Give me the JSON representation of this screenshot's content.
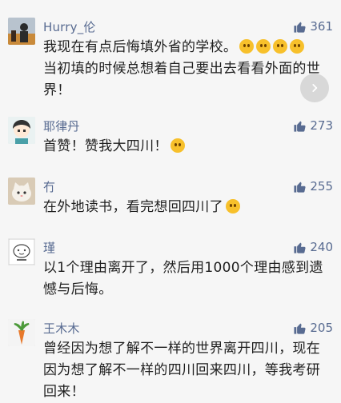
{
  "comments": [
    {
      "name": "Hurry_伦",
      "likes": "361",
      "text_parts": [
        "我现在有点后悔填外省的学校。",
        "当初填的时候总想着自己要出去看看外面的世界！"
      ],
      "avatar_icon": "user-photo-avatar"
    },
    {
      "name": "耶律丹",
      "likes": "273",
      "text": "首赞！赞我大四川！",
      "avatar_icon": "cartoon-boy-avatar"
    },
    {
      "name": "冇",
      "likes": "255",
      "text": "在外地读书，看完想回四川了",
      "avatar_icon": "cat-avatar"
    },
    {
      "name": "瑾",
      "likes": "240",
      "text": "以1个理由离开了，然后用1000个理由感到遗憾与后悔。",
      "avatar_icon": "sketch-avatar"
    },
    {
      "name": "王木木",
      "likes": "205",
      "text": "曾经因为想了解不一样的世界离开四川，现在因为想了解不一样的四川回来四川，等我考研回来！",
      "avatar_icon": "carrot-avatar"
    }
  ],
  "icons": {
    "like": "thumbs-up-icon",
    "next": "chevron-right-icon"
  },
  "colors": {
    "name": "#586b91",
    "text": "#1f1f1f",
    "background": "#f6f6f6"
  }
}
